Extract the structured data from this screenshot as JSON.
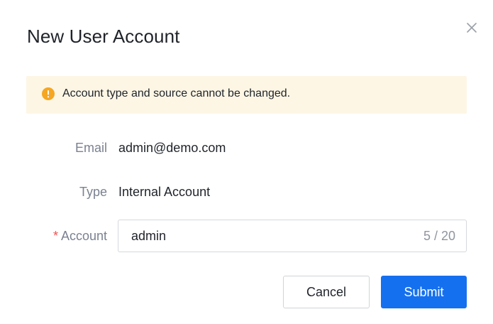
{
  "dialog": {
    "title": "New User Account",
    "close_icon": "close-icon"
  },
  "notice": {
    "icon": "warning-circle-icon",
    "text": "Account type and source cannot be changed."
  },
  "form": {
    "email": {
      "label": "Email",
      "value": "admin@demo.com"
    },
    "type": {
      "label": "Type",
      "value": "Internal Account"
    },
    "account": {
      "required_mark": "*",
      "label": "Account",
      "value": "admin",
      "counter": "5 / 20"
    }
  },
  "footer": {
    "cancel_label": "Cancel",
    "submit_label": "Submit"
  },
  "colors": {
    "primary": "#1570ef",
    "notice_bg": "#fdf6e5",
    "warning": "#f5a623",
    "required": "#f5504e"
  }
}
